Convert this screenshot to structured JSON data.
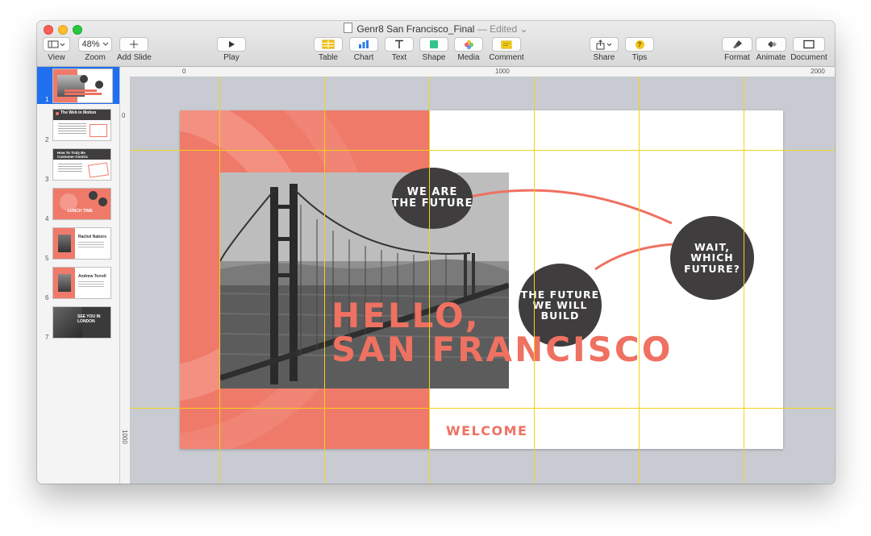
{
  "window": {
    "doc_name": "Genr8 San Francisco_Final",
    "doc_status": "— Edited",
    "title_chevron": "⌄"
  },
  "toolbar": {
    "view_label": "View",
    "zoom_label": "Zoom",
    "zoom_value": "48%",
    "add_slide_label": "Add Slide",
    "play_label": "Play",
    "table_label": "Table",
    "chart_label": "Chart",
    "text_label": "Text",
    "shape_label": "Shape",
    "media_label": "Media",
    "comment_label": "Comment",
    "share_label": "Share",
    "tips_label": "Tips",
    "tips_glyph": "?",
    "format_label": "Format",
    "animate_label": "Animate",
    "document_label": "Document"
  },
  "ruler": {
    "h_marks": [
      "0",
      "1000",
      "2000"
    ],
    "v_marks": [
      "0",
      "1000"
    ]
  },
  "sidebar": {
    "slides": [
      {
        "number": "1",
        "selected": true
      },
      {
        "number": "2",
        "heading": "The Web in Motion"
      },
      {
        "number": "3",
        "heading": "How To Truly Be Customer-Centric"
      },
      {
        "number": "4",
        "heading": "LUNCH TIME"
      },
      {
        "number": "5",
        "heading": "Rachel Nabors"
      },
      {
        "number": "6",
        "heading": "Andrew Terrell"
      },
      {
        "number": "7",
        "heading": "SEE YOU IN LONDON"
      }
    ]
  },
  "slide": {
    "bubble_1": "WE ARE\nTHE FUTURE",
    "bubble_2": "THE FUTURE\nWE WILL\nBUILD",
    "bubble_3": "WAIT,\nWHICH\nFUTURE?",
    "headline_line1": "HELLO,",
    "headline_line2": "SAN FRANCISCO",
    "welcome": "WELCOME"
  },
  "colors": {
    "accent_coral": "#f07a6a",
    "circle_dark": "#3f3d3e",
    "guide_yellow": "#f2d21a",
    "selection_blue": "#1f6ff0"
  }
}
